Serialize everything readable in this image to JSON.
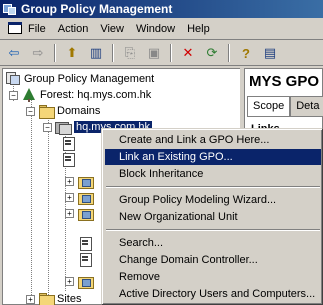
{
  "window": {
    "title": "Group Policy Management"
  },
  "menubar": {
    "items": [
      "File",
      "Action",
      "View",
      "Window",
      "Help"
    ]
  },
  "toolbar": {
    "buttons": [
      {
        "icon": "back-arrow-icon",
        "glyph": "⇦"
      },
      {
        "icon": "forward-arrow-icon",
        "glyph": "⇨"
      },
      {
        "icon": "up-folder-icon",
        "glyph": "⬆"
      },
      {
        "icon": "show-hide-tree-icon",
        "glyph": "▥"
      },
      {
        "icon": "copy-icon",
        "glyph": "⎘"
      },
      {
        "icon": "paste-icon",
        "glyph": "📋"
      },
      {
        "icon": "delete-icon",
        "glyph": "✕"
      },
      {
        "icon": "refresh-icon",
        "glyph": "⟳"
      },
      {
        "icon": "help-icon",
        "glyph": "?"
      },
      {
        "icon": "properties-icon",
        "glyph": "▤"
      }
    ]
  },
  "tree": {
    "root": "Group Policy Management",
    "forest": "Forest: hq.mys.com.hk",
    "domains": "Domains",
    "domain": "hq.mys.com.hk",
    "sites": "Sites"
  },
  "right_pane": {
    "title": "MYS GPO",
    "tabs": [
      "Scope",
      "Deta"
    ],
    "links_label": "Links"
  },
  "context_menu": {
    "items": [
      "Create and Link a GPO Here...",
      "Link an Existing GPO...",
      "Block Inheritance",
      "Group Policy Modeling Wizard...",
      "New Organizational Unit",
      "Search...",
      "Change Domain Controller...",
      "Remove",
      "Active Directory Users and Computers..."
    ],
    "highlighted_index": 1
  },
  "colors": {
    "titlebar": "#0a246a",
    "selection": "#0a246a",
    "face": "#d4d0c8",
    "delete_red": "#d00000"
  }
}
